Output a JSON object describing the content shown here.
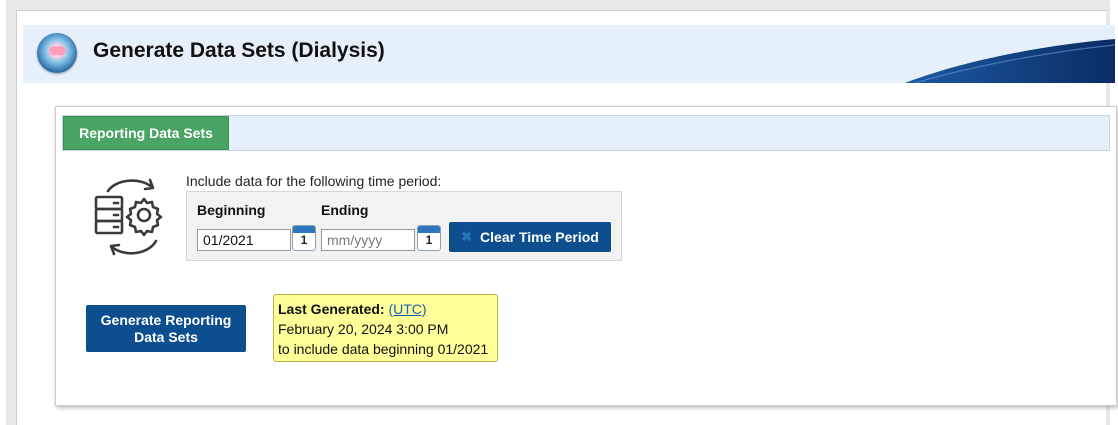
{
  "header": {
    "title": "Generate Data Sets (Dialysis)",
    "icon": "kidney-icon"
  },
  "tabs": [
    {
      "label": "Reporting Data Sets",
      "active": true
    }
  ],
  "time_period": {
    "instruction": "Include data for the following time period:",
    "beginning_label": "Beginning",
    "ending_label": "Ending",
    "beginning_value": "01/2021",
    "ending_value": "",
    "ending_placeholder": "mm/yyyy",
    "calendar_day": "1",
    "clear_label": "Clear Time Period"
  },
  "generate_button": {
    "line1": "Generate Reporting",
    "line2": "Data Sets"
  },
  "last_generated": {
    "label": "Last Generated:",
    "link": "(UTC)",
    "timestamp": "February 20, 2024 3:00 PM",
    "note": "to include data beginning 01/2021"
  },
  "colors": {
    "header_bg": "#e6f0fa",
    "tab_green": "#4aa564",
    "button_blue": "#0d4e8f",
    "note_yellow": "#ffff99"
  }
}
